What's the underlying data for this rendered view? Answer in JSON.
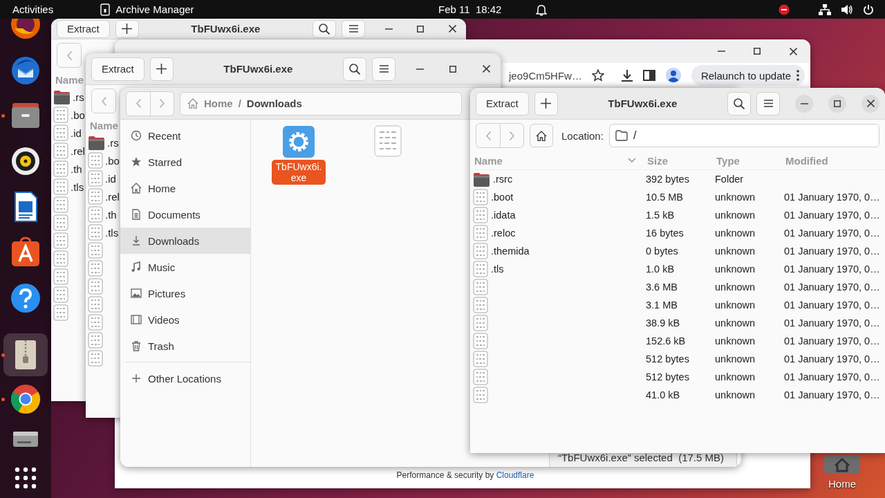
{
  "top_bar": {
    "activities": "Activities",
    "app_name": "Archive Manager",
    "clock": "Feb 11  18:42"
  },
  "dock": [
    {
      "kind": "firefox",
      "running": false,
      "selected": false
    },
    {
      "kind": "thunderbird",
      "running": false,
      "selected": false
    },
    {
      "kind": "files",
      "running": true,
      "selected": false
    },
    {
      "kind": "rhythmbox",
      "running": false,
      "selected": false
    },
    {
      "kind": "writer",
      "running": false,
      "selected": false
    },
    {
      "kind": "appstore",
      "running": false,
      "selected": false
    },
    {
      "kind": "help",
      "running": false,
      "selected": false
    },
    {
      "kind": "archive",
      "running": true,
      "selected": true
    },
    {
      "kind": "chrome",
      "running": true,
      "selected": false
    },
    {
      "kind": "drive",
      "running": false,
      "selected": false
    },
    {
      "kind": "apps",
      "running": false,
      "selected": false
    }
  ],
  "desktop": {
    "home_label": "Home"
  },
  "archive_back": [
    {
      "title": "TbFUwx6i.exe",
      "extract": "Extract",
      "name_header": "Name",
      "rows": [
        {
          "kind": "folder",
          "name": ".rs"
        },
        {
          "kind": "file",
          "name": ".bo"
        },
        {
          "kind": "file",
          "name": ".id"
        },
        {
          "kind": "file",
          "name": ".rel"
        },
        {
          "kind": "file",
          "name": ".th"
        },
        {
          "kind": "file",
          "name": ".tls"
        },
        {
          "kind": "file"
        },
        {
          "kind": "file"
        },
        {
          "kind": "file"
        },
        {
          "kind": "file"
        },
        {
          "kind": "file"
        },
        {
          "kind": "file"
        },
        {
          "kind": "file"
        }
      ]
    },
    {
      "title": "TbFUwx6i.exe",
      "extract": "Extract",
      "name_header": "Name",
      "rows": [
        {
          "kind": "folder",
          "name": ".rs"
        },
        {
          "kind": "file",
          "name": ".bo"
        },
        {
          "kind": "file",
          "name": ".id"
        },
        {
          "kind": "file",
          "name": ".rel"
        },
        {
          "kind": "file",
          "name": ".th"
        },
        {
          "kind": "file",
          "name": ".tls"
        },
        {
          "kind": "file"
        },
        {
          "kind": "file"
        },
        {
          "kind": "file"
        },
        {
          "kind": "file"
        },
        {
          "kind": "file"
        },
        {
          "kind": "file"
        },
        {
          "kind": "file"
        }
      ]
    }
  ],
  "browser": {
    "url": "jeo9Cm5HFw…",
    "relaunch": "Relaunch to update",
    "footer": "Performance & security by",
    "footer_link": "Cloudflare"
  },
  "files": {
    "path": [
      {
        "kind": "segment",
        "label": "Home"
      },
      {
        "kind": "separator",
        "label": "/"
      },
      {
        "kind": "segment",
        "label": "Downloads"
      }
    ],
    "sidebar": [
      {
        "kind": "recent",
        "label": "Recent",
        "selected": false
      },
      {
        "kind": "starred",
        "label": "Starred",
        "selected": false
      },
      {
        "kind": "home",
        "label": "Home",
        "selected": false
      },
      {
        "kind": "documents",
        "label": "Documents",
        "selected": false
      },
      {
        "kind": "downloads",
        "label": "Downloads",
        "selected": true
      },
      {
        "kind": "music",
        "label": "Music",
        "selected": false
      },
      {
        "kind": "pictures",
        "label": "Pictures",
        "selected": false
      },
      {
        "kind": "videos",
        "label": "Videos",
        "selected": false
      },
      {
        "kind": "trash",
        "label": "Trash",
        "selected": false
      },
      {
        "kind": "other",
        "label": "Other Locations",
        "selected": false
      }
    ],
    "items": [
      {
        "kind": "executable",
        "label": "TbFUwx6i.exe",
        "selected": true
      },
      {
        "kind": "binary",
        "selected": false
      }
    ],
    "status": "“TbFUwx6i.exe” selected  (17.5 MB)"
  },
  "archive_front": {
    "title": "TbFUwx6i.exe",
    "extract": "Extract",
    "location_label": "Location:",
    "location": "/",
    "columns": [
      "Name",
      "Size",
      "Type",
      "Modified"
    ],
    "rows": [
      {
        "kind": "folder",
        "name": ".rsrc",
        "size": "392 bytes",
        "type": "Folder"
      },
      {
        "kind": "file",
        "name": ".boot",
        "size": "10.5 MB",
        "type": "unknown",
        "modified": "01 January 1970, 0…"
      },
      {
        "kind": "file",
        "name": ".idata",
        "size": "1.5 kB",
        "type": "unknown",
        "modified": "01 January 1970, 0…"
      },
      {
        "kind": "file",
        "name": ".reloc",
        "size": "16 bytes",
        "type": "unknown",
        "modified": "01 January 1970, 0…"
      },
      {
        "kind": "file",
        "name": ".themida",
        "size": "0 bytes",
        "type": "unknown",
        "modified": "01 January 1970, 0…"
      },
      {
        "kind": "file",
        "name": ".tls",
        "size": "1.0 kB",
        "type": "unknown",
        "modified": "01 January 1970, 0…"
      },
      {
        "kind": "file",
        "size": "3.6 MB",
        "type": "unknown",
        "modified": "01 January 1970, 0…"
      },
      {
        "kind": "file",
        "size": "3.1 MB",
        "type": "unknown",
        "modified": "01 January 1970, 0…"
      },
      {
        "kind": "file",
        "size": "38.9 kB",
        "type": "unknown",
        "modified": "01 January 1970, 0…"
      },
      {
        "kind": "file",
        "size": "152.6 kB",
        "type": "unknown",
        "modified": "01 January 1970, 0…"
      },
      {
        "kind": "file",
        "size": "512 bytes",
        "type": "unknown",
        "modified": "01 January 1970, 0…"
      },
      {
        "kind": "file",
        "size": "512 bytes",
        "type": "unknown",
        "modified": "01 January 1970, 0…"
      },
      {
        "kind": "file",
        "size": "41.0 kB",
        "type": "unknown",
        "modified": "01 January 1970, 0…"
      }
    ]
  }
}
